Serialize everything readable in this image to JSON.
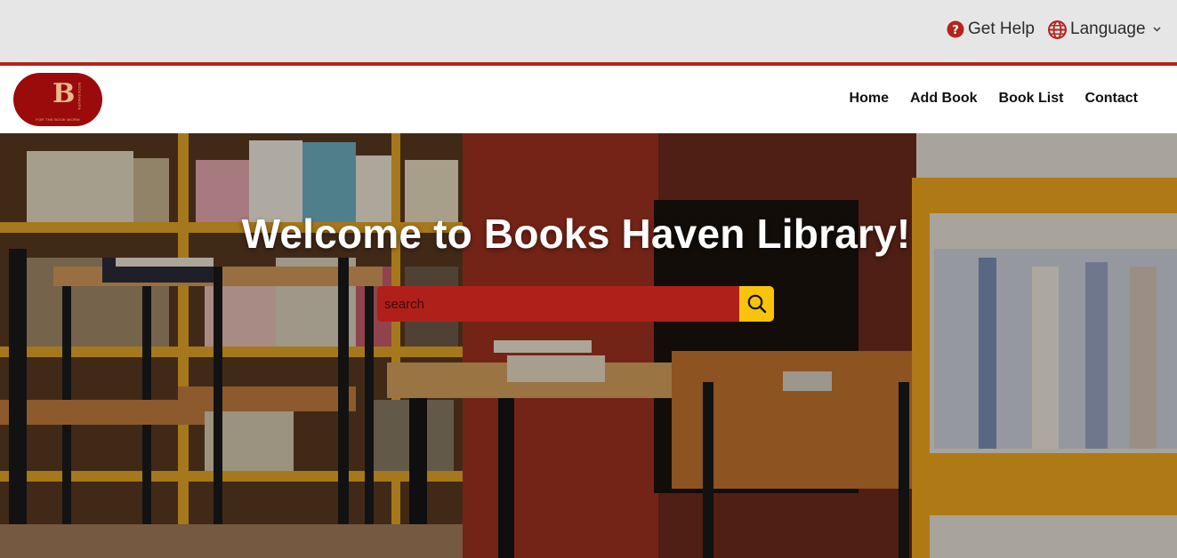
{
  "topbar": {
    "help_label": "Get Help",
    "language_label": "Language",
    "icons": {
      "help": "question-circle-icon",
      "language": "globe-icon",
      "dropdown": "chevron-down-icon"
    }
  },
  "brand": {
    "logo_letter": "B",
    "logo_side_text": "BOOKSHAVEN",
    "logo_tagline": "FOR THE BOOK WORM",
    "colors": {
      "primary": "#9b0b0b",
      "accent_line": "#b2251d",
      "gold": "#f8c30d"
    }
  },
  "nav": {
    "items": [
      {
        "label": "Home"
      },
      {
        "label": "Add Book"
      },
      {
        "label": "Book List"
      },
      {
        "label": "Contact"
      }
    ]
  },
  "hero": {
    "title": "Welcome to Books Haven Library!",
    "search": {
      "placeholder": "search",
      "value": "",
      "button_icon": "search-icon"
    }
  }
}
